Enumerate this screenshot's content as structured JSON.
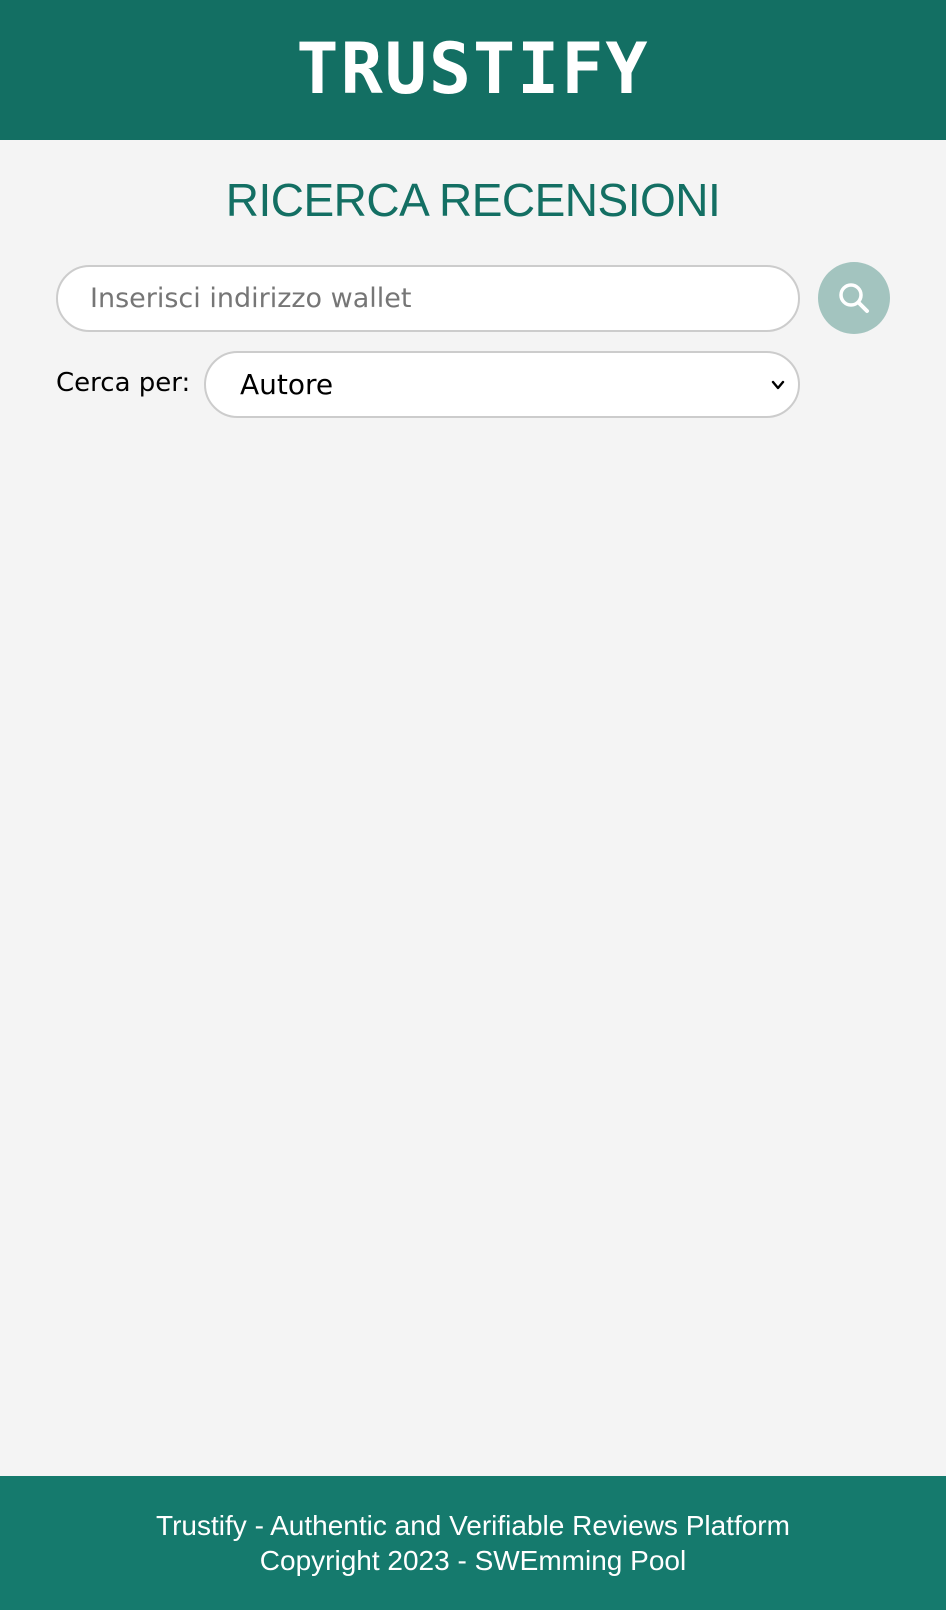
{
  "header": {
    "logo_text": "TRUSTIFY"
  },
  "main": {
    "title": "RICERCA RECENSIONI",
    "search": {
      "placeholder": "Inserisci indirizzo wallet",
      "value": "",
      "button_icon": "search-icon"
    },
    "filter": {
      "label": "Cerca per:",
      "selected": "Autore",
      "icon": "chevron-down-icon"
    }
  },
  "footer": {
    "line1": "Trustify - Authentic and Verifiable Reviews Platform",
    "line2": "Copyright 2023 - SWEmming Pool"
  },
  "colors": {
    "primary": "#136f63",
    "footer": "#157a6d",
    "background": "#f4f4f4",
    "search_button": "#a3c4bf",
    "border": "#cccccc"
  }
}
